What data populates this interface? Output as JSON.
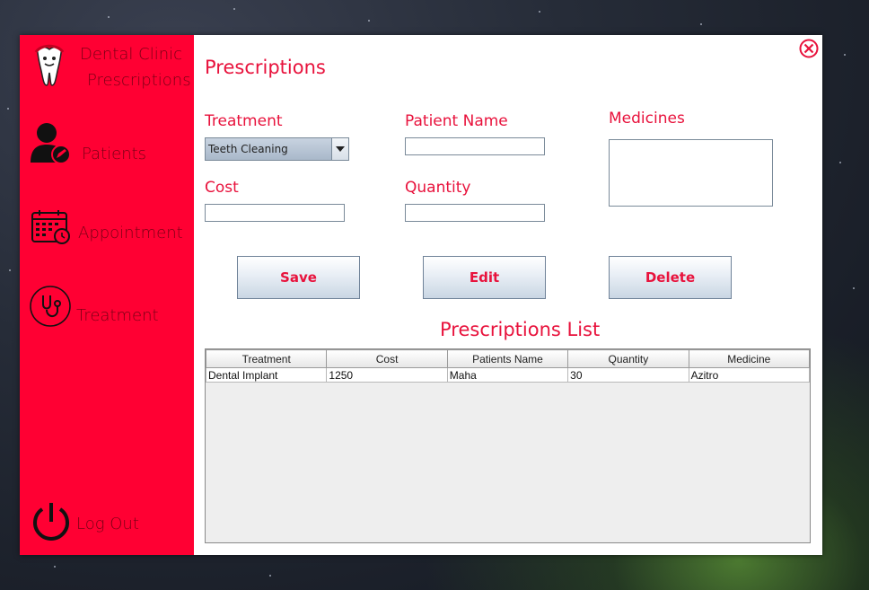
{
  "app": {
    "title_line1": "Dental Clinic",
    "title_line2": "Prescriptions"
  },
  "colors": {
    "sidebar": "#ff0033",
    "accent": "#e8123c",
    "sidebar_text": "#7a0015"
  },
  "sidebar": {
    "items": [
      {
        "label": "Patients",
        "icon": "patient-icon"
      },
      {
        "label": "Appointment",
        "icon": "calendar-icon"
      },
      {
        "label": "Treatment",
        "icon": "stethoscope-icon"
      }
    ],
    "logout_label": "Log Out",
    "logout_icon": "power-icon"
  },
  "main": {
    "page_title": "Prescriptions",
    "close_icon": "close-icon",
    "form": {
      "treatment_label": "Treatment",
      "treatment_value": "Teeth Cleaning",
      "patient_name_label": "Patient Name",
      "patient_name_value": "",
      "medicines_label": "Medicines",
      "medicines_value": "",
      "cost_label": "Cost",
      "cost_value": "",
      "quantity_label": "Quantity",
      "quantity_value": ""
    },
    "buttons": {
      "save": "Save",
      "edit": "Edit",
      "delete": "Delete"
    },
    "list_title": "Prescriptions List",
    "table": {
      "columns": [
        "Treatment",
        "Cost",
        "Patients Name",
        "Quantity",
        "Medicine"
      ],
      "rows": [
        [
          "Dental Implant",
          "1250",
          "Maha",
          "30",
          "Azitro"
        ]
      ]
    }
  }
}
